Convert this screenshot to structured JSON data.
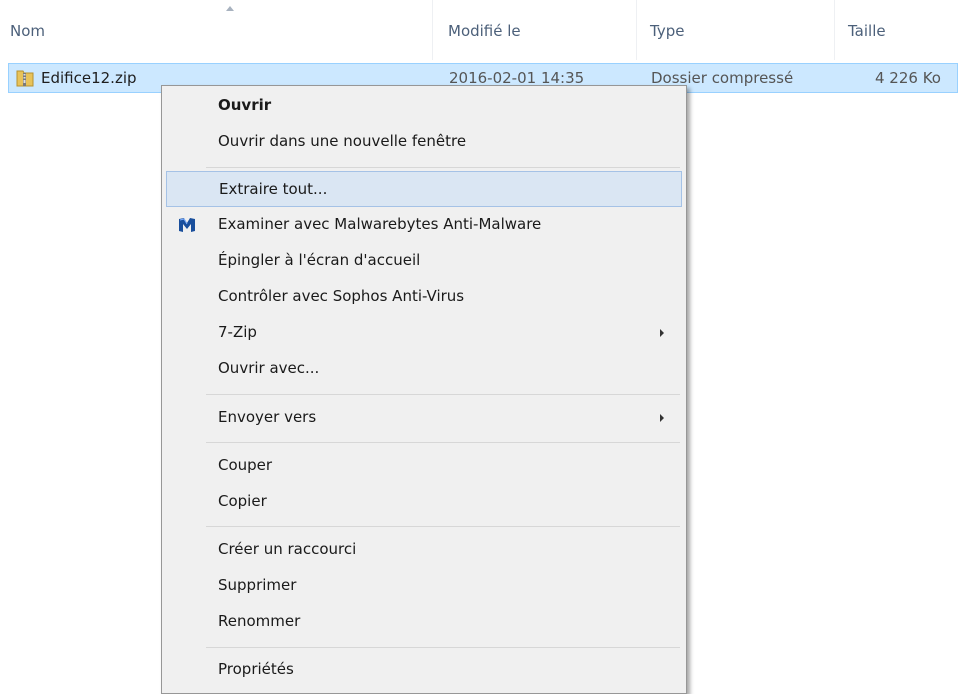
{
  "columns": {
    "name": "Nom",
    "modified": "Modifié le",
    "type": "Type",
    "size": "Taille"
  },
  "file": {
    "name": "Edifice12.zip",
    "modified": "2016-02-01 14:35",
    "type": "Dossier compressé",
    "size": "4 226 Ko",
    "icon": "zip-folder-icon"
  },
  "context_menu": {
    "items": [
      {
        "label": "Ouvrir"
      },
      {
        "label": "Ouvrir dans une nouvelle fenêtre"
      },
      {
        "label": "Extraire tout..."
      },
      {
        "label": "Examiner avec Malwarebytes Anti-Malware",
        "icon": "malwarebytes-icon"
      },
      {
        "label": "Épingler à l'écran d'accueil"
      },
      {
        "label": "Contrôler avec Sophos Anti-Virus"
      },
      {
        "label": "7-Zip"
      },
      {
        "label": "Ouvrir avec..."
      },
      {
        "label": "Envoyer vers"
      },
      {
        "label": "Couper"
      },
      {
        "label": "Copier"
      },
      {
        "label": "Créer un raccourci"
      },
      {
        "label": "Supprimer"
      },
      {
        "label": "Renommer"
      },
      {
        "label": "Propriétés"
      }
    ]
  },
  "colors": {
    "selection": "#cce8ff",
    "menu_background": "#f0f0f0",
    "menu_highlight": "#dae6f3",
    "header_text": "#4c607a"
  }
}
